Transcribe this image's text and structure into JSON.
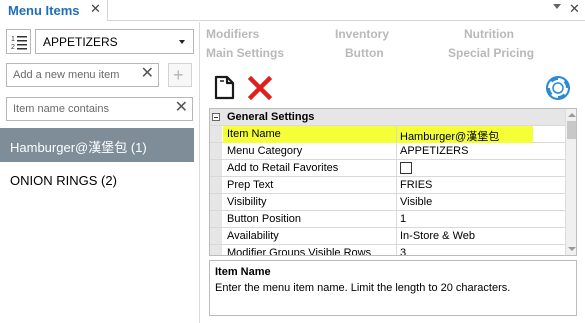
{
  "tab": {
    "title": "Menu Items",
    "close_glyph": "✕",
    "right_close_glyph": "✕"
  },
  "left": {
    "category_value": "APPETIZERS",
    "add_placeholder": "Add a new menu item",
    "search_placeholder": "Item name contains",
    "clear_glyph": "✕",
    "add_glyph": "+",
    "items": [
      {
        "label": "Hamburger@漢堡包 (1)",
        "selected": true
      },
      {
        "label": "ONION RINGS (2)",
        "selected": false
      }
    ]
  },
  "nav": {
    "row1": [
      "Modifiers",
      "Inventory",
      "Nutrition"
    ],
    "row2": [
      "Main Settings",
      "Button",
      "Special Pricing"
    ]
  },
  "toolbar": {
    "icons": [
      "copy-icon",
      "delete-icon",
      "help-lifebuoy-icon"
    ],
    "colors": {
      "delete": "#e0201c",
      "help": "#2a8ad4"
    }
  },
  "grid": {
    "section": "General Settings",
    "rows": [
      {
        "label": "Item Name",
        "value": "Hamburger@漢堡包",
        "highlight": true
      },
      {
        "label": "Menu Category",
        "value": "APPETIZERS"
      },
      {
        "label": "Add to Retail Favorites",
        "value": "",
        "checkbox": true,
        "checked": false
      },
      {
        "label": "Prep Text",
        "value": "FRIES"
      },
      {
        "label": "Visibility",
        "value": "Visible"
      },
      {
        "label": "Button Position",
        "value": "1"
      },
      {
        "label": "Availability",
        "value": "In-Store & Web"
      },
      {
        "label": "Modifier Groups Visible Rows",
        "value": "3"
      }
    ]
  },
  "description": {
    "title": "Item Name",
    "text": "Enter the menu item name. Limit the length to 20 characters."
  },
  "colors": {
    "tab_title": "#1e6fb8",
    "selected_item_bg": "#7e8d98",
    "highlight": "#f4ff38"
  }
}
